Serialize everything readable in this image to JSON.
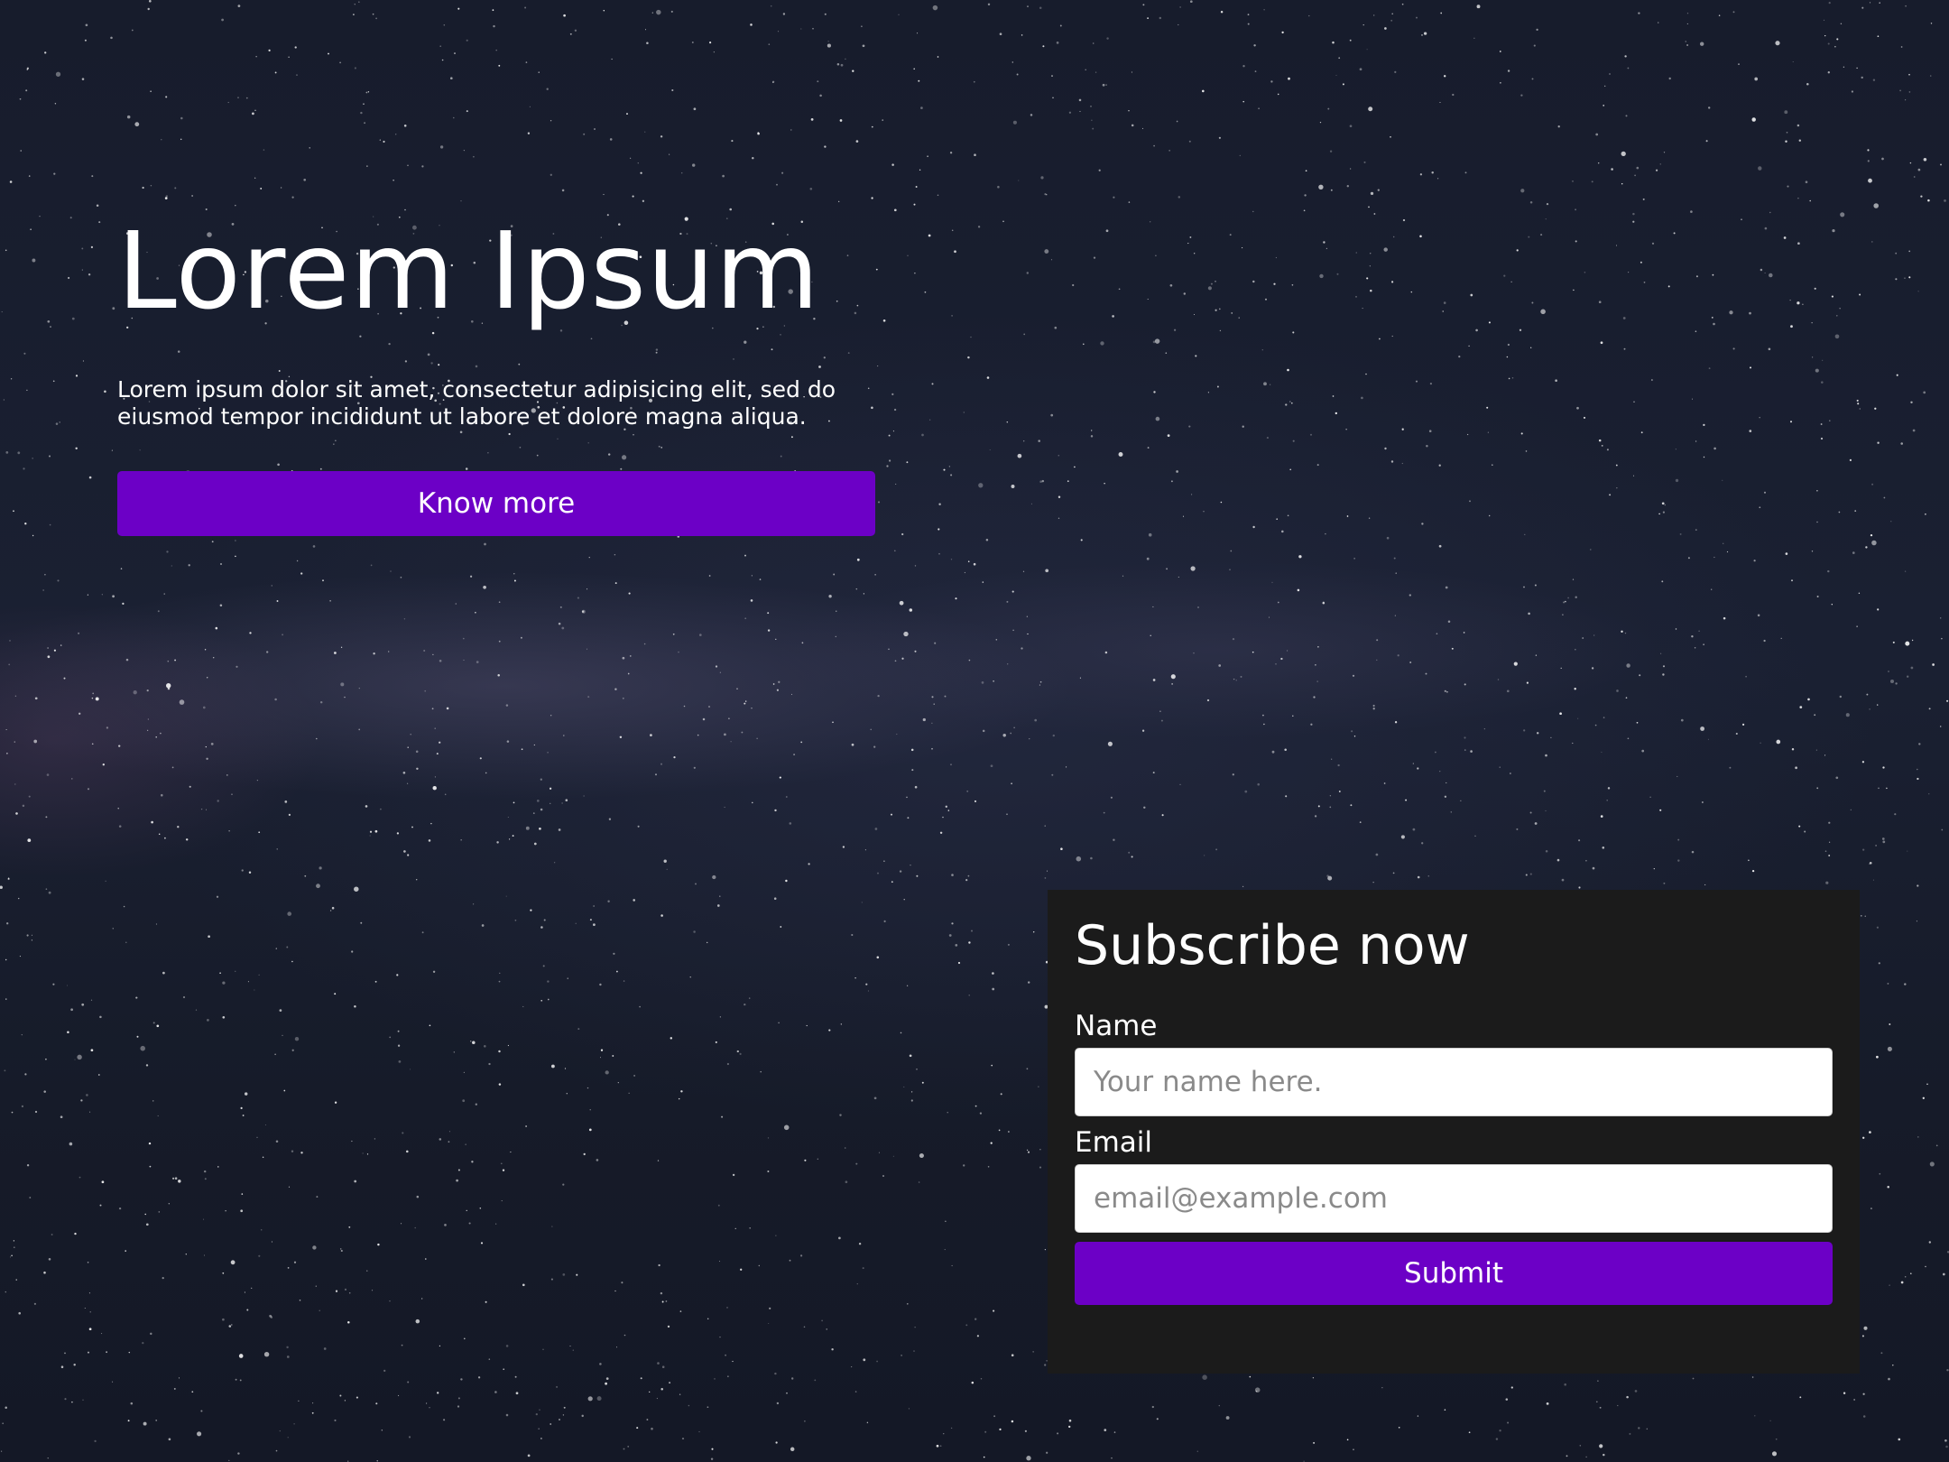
{
  "hero": {
    "title": "Lorem Ipsum",
    "text": "Lorem ipsum dolor sit amet, consectetur adipisicing elit, sed do eiusmod tempor incididunt ut labore et dolore magna aliqua.",
    "button_label": "Know more"
  },
  "subscribe": {
    "title": "Subscribe now",
    "name_label": "Name",
    "name_placeholder": "Your name here.",
    "email_label": "Email",
    "email_placeholder": "email@example.com",
    "submit_label": "Submit"
  },
  "colors": {
    "accent": "#6c00c6",
    "panel_background": "#1b1b1b",
    "page_background": "#161b2a",
    "text": "#ffffff"
  }
}
